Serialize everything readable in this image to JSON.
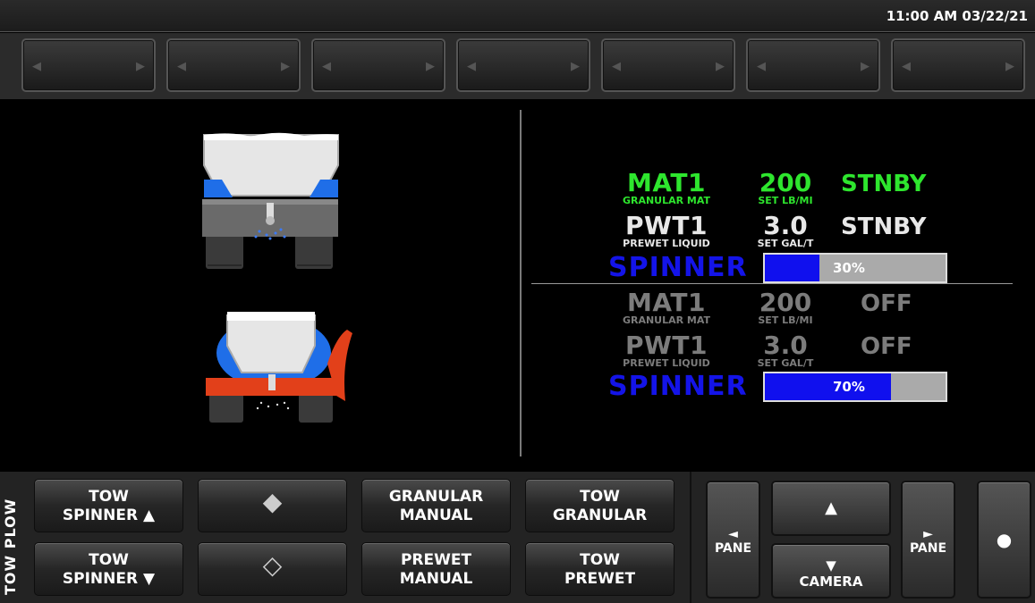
{
  "status": {
    "clock": "11:00 AM 03/22/21"
  },
  "selectors": {
    "count": 7,
    "left_arrow": "◀",
    "right_arrow": "▶"
  },
  "truck_pane": {
    "row1": {
      "material": "MAT1",
      "material_desc": "GRANULAR MAT",
      "set_value": "200",
      "set_unit": "SET LB/MI",
      "state": "STNBY"
    },
    "row2": {
      "material": "PWT1",
      "material_desc": "PREWET LIQUID",
      "set_value": "3.0",
      "set_unit": "SET GAL/T",
      "state": "STNBY"
    },
    "spinner": {
      "label": "SPINNER",
      "percent_text": "30%",
      "percent": 30
    }
  },
  "tow_pane": {
    "row1": {
      "material": "MAT1",
      "material_desc": "GRANULAR MAT",
      "set_value": "200",
      "set_unit": "SET LB/MI",
      "state": "OFF"
    },
    "row2": {
      "material": "PWT1",
      "material_desc": "PREWET LIQUID",
      "set_value": "3.0",
      "set_unit": "SET GAL/T",
      "state": "OFF"
    },
    "spinner": {
      "label": "SPINNER",
      "percent_text": "70%",
      "percent": 70
    }
  },
  "bottom": {
    "side_label": "TOW PLOW",
    "buttons": {
      "tow_spinner_up": {
        "line1": "TOW",
        "line2": "SPINNER ▲"
      },
      "tow_spinner_down": {
        "line1": "TOW",
        "line2": "SPINNER ▼"
      },
      "diamond_filled": {
        "icon": "◆"
      },
      "diamond_outline": {
        "icon": "◇"
      },
      "granular_manual": {
        "line1": "GRANULAR",
        "line2": "MANUAL"
      },
      "prewet_manual": {
        "line1": "PREWET",
        "line2": "MANUAL"
      },
      "tow_granular": {
        "line1": "TOW",
        "line2": "GRANULAR"
      },
      "tow_prewet": {
        "line1": "TOW",
        "line2": "PREWET"
      }
    },
    "nav": {
      "pane_left": {
        "arrow": "◄",
        "label": "PANE"
      },
      "pane_right": {
        "arrow": "►",
        "label": "PANE"
      },
      "up": {
        "arrow": "▲"
      },
      "camera": {
        "arrow": "▼",
        "label": "CAMERA"
      },
      "dot": {
        "icon": "●"
      }
    }
  },
  "colors": {
    "active_green": "#2ee62e",
    "spinner_blue": "#1414e8",
    "inactive_gray": "#7c7c7c"
  }
}
